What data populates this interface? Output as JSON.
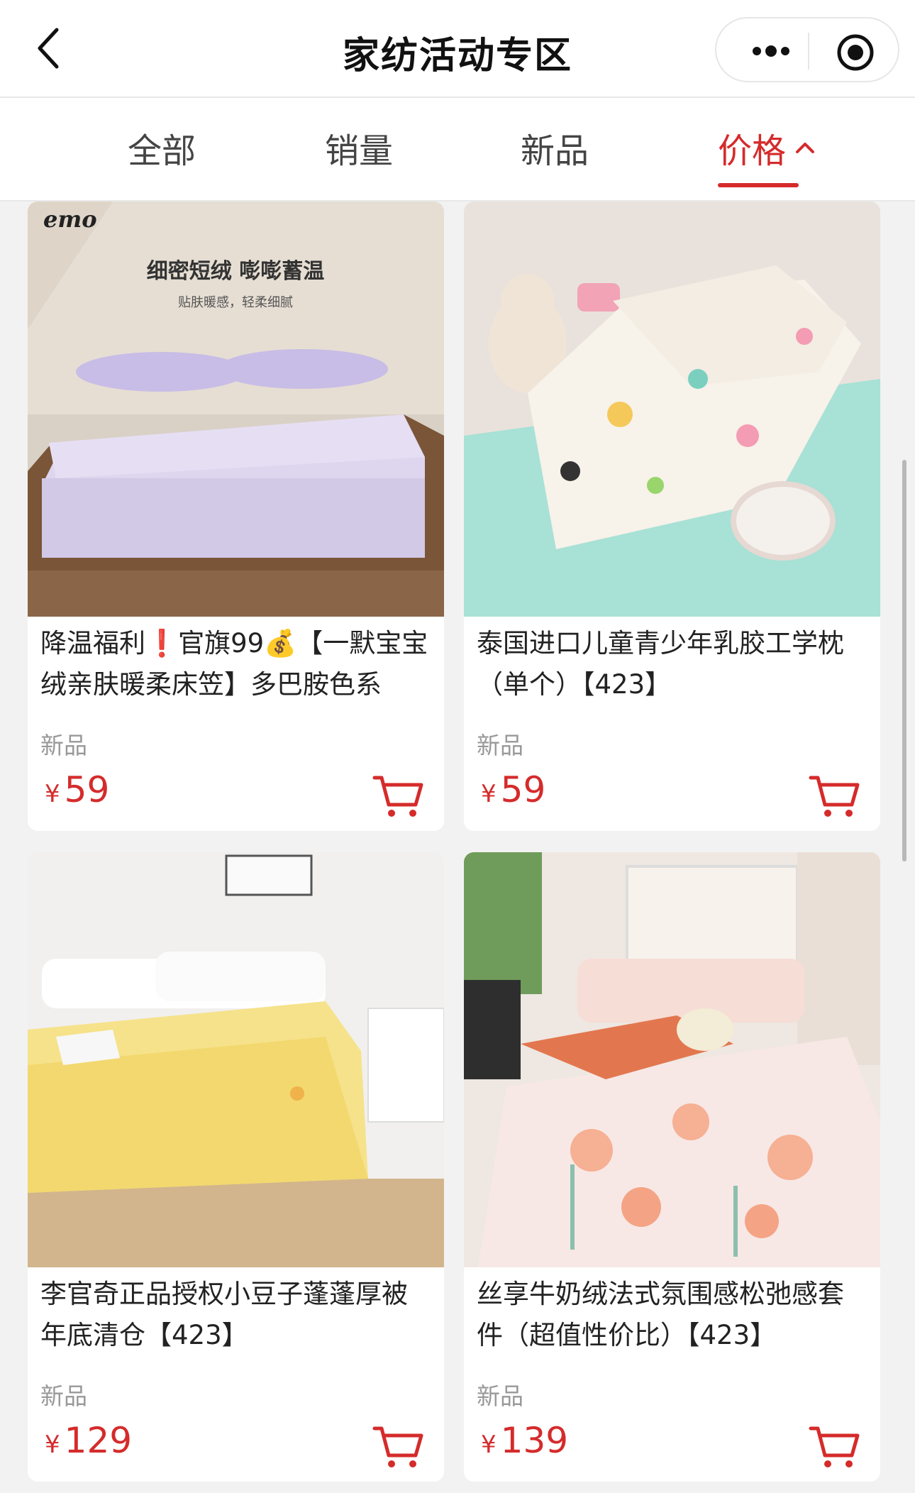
{
  "nav": {
    "title": "家纺活动专区",
    "back_icon": "chevron-left-icon",
    "more_icon": "more-dots-icon",
    "close_icon": "target-close-icon"
  },
  "tabs": [
    {
      "label": "全部",
      "active": false
    },
    {
      "label": "销量",
      "active": false
    },
    {
      "label": "新品",
      "active": false
    },
    {
      "label": "价格",
      "active": true,
      "sort_icon": "chevron-up-icon"
    }
  ],
  "products": [
    {
      "name": "降温福利❗️官旗99💰【一默宝宝绒亲肤暖柔床笠】多巴胺色系",
      "tag": "新品",
      "currency": "¥",
      "price": "59",
      "image": {
        "brand": "emo",
        "headline": "细密短绒  嘭嘭蓄温",
        "subline": "贴肤暖感，轻柔细腻"
      }
    },
    {
      "name": "泰国进口儿童青少年乳胶工学枕（单个）【423】",
      "tag": "新品",
      "currency": "¥",
      "price": "59"
    },
    {
      "name": "李官奇正品授权小豆子蓬蓬厚被年底清仓【423】",
      "tag": "新品",
      "currency": "¥",
      "price": "129"
    },
    {
      "name": "丝享牛奶绒法式氛围感松弛感套件（超值性价比）【423】",
      "tag": "新品",
      "currency": "¥",
      "price": "139"
    }
  ],
  "colors": {
    "accent": "#d52b2b",
    "muted": "#999999",
    "background": "#f2f2f2"
  }
}
